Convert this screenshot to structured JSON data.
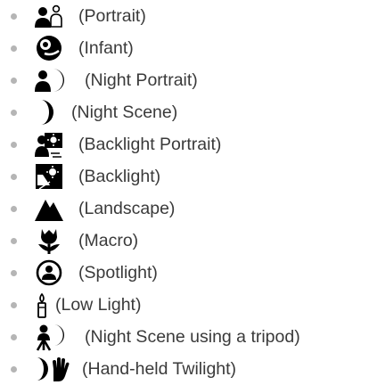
{
  "scene_modes": [
    {
      "icon": "portrait-icon",
      "label": "(Portrait)"
    },
    {
      "icon": "infant-icon",
      "label": "(Infant)"
    },
    {
      "icon": "night-portrait-icon",
      "label": "(Night Portrait)"
    },
    {
      "icon": "night-scene-icon",
      "label": "(Night Scene)"
    },
    {
      "icon": "backlight-portrait-icon",
      "label": "(Backlight Portrait)"
    },
    {
      "icon": "backlight-icon",
      "label": "(Backlight)"
    },
    {
      "icon": "landscape-icon",
      "label": "(Landscape)"
    },
    {
      "icon": "macro-icon",
      "label": "(Macro)"
    },
    {
      "icon": "spotlight-icon",
      "label": "(Spotlight)"
    },
    {
      "icon": "low-light-icon",
      "label": "(Low Light)"
    },
    {
      "icon": "night-scene-tripod-icon",
      "label": "(Night Scene using a tripod)"
    },
    {
      "icon": "hand-held-twilight-icon",
      "label": "(Hand-held Twilight)"
    }
  ],
  "colors": {
    "text": "#3a3a3a",
    "icon": "#000000",
    "bullet": "#b5b5b5"
  }
}
